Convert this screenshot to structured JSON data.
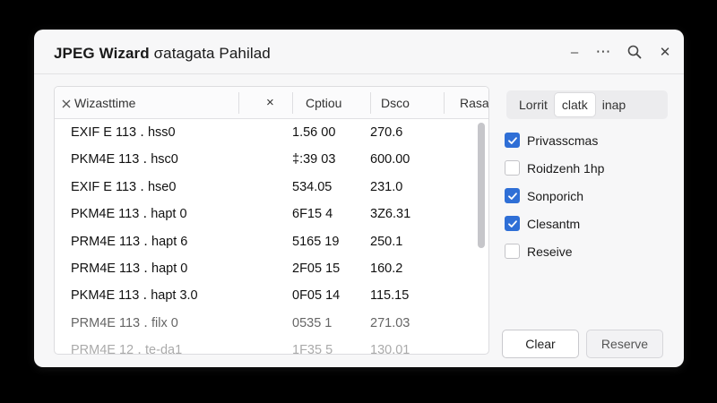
{
  "window": {
    "title_bold": "JPEG Wizard",
    "title_rest": " σatagata Pahilad"
  },
  "titlebar_icons": [
    "minimize-icon",
    "more-icon",
    "search-icon",
    "close-icon"
  ],
  "titlebar_glyphs": {
    "minimize": "–",
    "more": "⋯",
    "close": "✕"
  },
  "table": {
    "headers": {
      "name": "Wizasttime",
      "close": "×",
      "option": "Cptiou",
      "desc": "Dsco",
      "extra": "Rasa"
    },
    "rows": [
      {
        "name": "EXIF  E 113  ․ hss0",
        "col2": "1.56  00",
        "col3": "270.6"
      },
      {
        "name": "PKM4E 113  ․ hsc0",
        "col2": "‡:39 03",
        "col3": "600.00"
      },
      {
        "name": "EXIF  E 113  ․ hse0",
        "col2": "534.05",
        "col3": "231.0"
      },
      {
        "name": "PKM4E 113  ․ hapt  0",
        "col2": "6F15  4",
        "col3": "3Z6.31"
      },
      {
        "name": "PRM4E 113  ․ hapt  6",
        "col2": "5165 19",
        "col3": "250.1"
      },
      {
        "name": "PRM4E 113  ․ hapt  0",
        "col2": "2F05  15",
        "col3": "160.2"
      },
      {
        "name": "PKM4E 113  ․ hapt  3.0",
        "col2": "0F05 14",
        "col3": "115.15"
      },
      {
        "name": "PRM4E 113  ․ filx  0",
        "col2": "0535  1",
        "col3": "271.03"
      },
      {
        "name": "PRM4E 12  ․ te-da1",
        "col2": "1F35  5",
        "col3": "130.01"
      }
    ]
  },
  "segmented": {
    "items": [
      "Lorrit",
      "clatk",
      "inap"
    ],
    "active_index": 1
  },
  "checkboxes": [
    {
      "label": "Privasscmas",
      "checked": true
    },
    {
      "label": "Roidzenh  1hp",
      "checked": false
    },
    {
      "label": "Sonporich",
      "checked": true
    },
    {
      "label": "Clesantm",
      "checked": true
    },
    {
      "label": "Reseive",
      "checked": false
    }
  ],
  "buttons": {
    "clear": "Clear",
    "reserve": "Reserve"
  },
  "colors": {
    "accent": "#2f6fd6",
    "window_bg": "#f7f7f8",
    "backdrop": "#000000"
  }
}
